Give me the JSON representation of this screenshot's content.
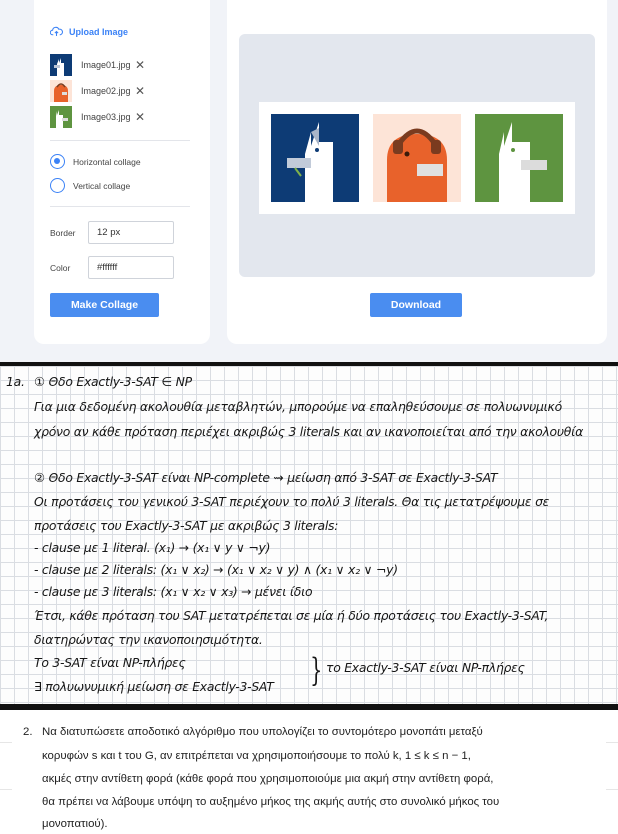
{
  "app": {
    "upload_label": "Upload Image",
    "accent_color": "#3b82f6",
    "files": [
      {
        "name": "Image01.jpg",
        "bg": "#0d3b75"
      },
      {
        "name": "Image02.jpg",
        "bg": "#fde4d7"
      },
      {
        "name": "Image03.jpg",
        "bg": "#5e9440"
      }
    ],
    "layout_options": [
      {
        "label": "Horizontal collage",
        "selected": true
      },
      {
        "label": "Vertical collage",
        "selected": false
      }
    ],
    "border_label": "Border",
    "border_value": "12 px",
    "color_label": "Color",
    "color_value": "#ffffff",
    "make_collage_label": "Make Collage",
    "download_label": "Download"
  },
  "notes": {
    "problem_label": "1a.",
    "lines": [
      "① Θδο Exactly-3-SAT ∈ NP",
      "Για μια δεδομένη ακολουθία μεταβλητών, μπορούμε να επαληθεύσουμε σε πολυωνυμικό",
      "χρόνο αν κάθε πρόταση περιέχει ακριβώς 3 literals και αν ικανοποιείται από την ακολουθία",
      "② Θδο Exactly-3-SAT είναι NP-complete ⇝ μείωση από 3-SAT σε Exactly-3-SAT",
      "Οι προτάσεις του γενικού 3-SAT περιέχουν το πολύ 3 literals. Θα τις μετατρέψουμε σε",
      "προτάσεις του Exactly-3-SAT με ακριβώς 3 literals:",
      "- clause με 1 literal. (x₁) → (x₁ ∨ y ∨ ¬y)",
      "- clause με 2 literals: (x₁ ∨ x₂) → (x₁ ∨ x₂ ∨ y) ∧ (x₁ ∨ x₂ ∨ ¬y)",
      "- clause με 3 literals: (x₁ ∨ x₂ ∨ x₃) → μένει ίδιο",
      "Έτσι, κάθε πρόταση του SAT μετατρέπεται σε μία ή δύο προτάσεις του Exactly-3-SAT,",
      "διατηρώντας την ικανοποιησιμότητα.",
      "Το 3-SAT είναι NP-πλήρες",
      "∃ πολυωνυμική μείωση σε Exactly-3-SAT",
      "το Exactly-3-SAT είναι NP-πλήρες"
    ]
  },
  "problem": {
    "number": "2.",
    "lines": [
      "Να διατυπώσετε αποδοτικό αλγόριθμο που υπολογίζει το συντομότερο μονοπάτι μεταξύ",
      "κορυφών s και t του G, αν επιτρέπεται να χρησιμοποιήσουμε το πολύ k, 1 ≤ k ≤ n − 1,",
      "ακμές στην αντίθετη φορά (κάθε φορά που χρησιμοποιούμε μια ακμή στην αντίθετη φορά,",
      "θα πρέπει να λάβουμε υπόψη το αυξημένο μήκος της ακμής αυτής στο συνολικό μήκος του",
      "μονοπατιού)."
    ]
  }
}
